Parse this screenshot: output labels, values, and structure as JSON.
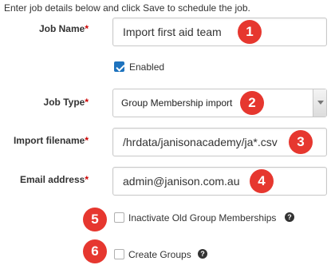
{
  "intro_text": "Enter job details below and click Save to schedule the job.",
  "required_marker": "*",
  "fields": {
    "job_name": {
      "label": "Job Name",
      "value": "Import first aid team",
      "badge": "1"
    },
    "enabled": {
      "label": "Enabled",
      "checked": true
    },
    "job_type": {
      "label": "Job Type",
      "value": "Group Membership import",
      "badge": "2"
    },
    "import_filename": {
      "label": "Import filename",
      "value": "/hrdata/janisonacademy/ja*.csv",
      "badge": "3"
    },
    "email_address": {
      "label": "Email address",
      "value": "admin@janison.com.au",
      "badge": "4"
    },
    "inactivate_old": {
      "label": "Inactivate Old Group Memberships",
      "checked": false,
      "badge": "5",
      "help": "?"
    },
    "create_groups": {
      "label": "Create Groups",
      "checked": false,
      "badge": "6",
      "help": "?"
    }
  },
  "colors": {
    "badge": "#e6372f",
    "checkbox_checked": "#1e73be",
    "required": "#cc0000"
  }
}
